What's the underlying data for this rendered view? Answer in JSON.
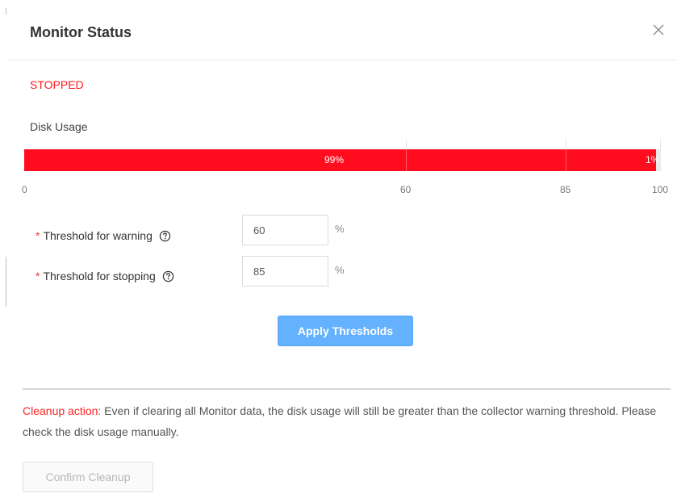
{
  "dialog": {
    "title": "Monitor Status"
  },
  "status": {
    "text": "STOPPED",
    "color": "#ff1a1a"
  },
  "disk_usage": {
    "label": "Disk Usage",
    "value_percent": 99.3,
    "value_label": "99%",
    "overflow_label": "1%",
    "bar_color": "#ff0c1e",
    "scale_max": 100,
    "ticks": [
      {
        "value": 0,
        "label": "0"
      },
      {
        "value": 60,
        "label": "60"
      },
      {
        "value": 85,
        "label": "85"
      },
      {
        "value": 100,
        "label": "100"
      }
    ]
  },
  "thresholds": {
    "warning": {
      "required_mark": "*",
      "label": "Threshold for warning",
      "value": "60",
      "unit": "%"
    },
    "stopping": {
      "required_mark": "*",
      "label": "Threshold for stopping",
      "value": "85",
      "unit": "%"
    },
    "apply_label": "Apply Thresholds",
    "apply_color": "#63b1ff"
  },
  "cleanup": {
    "heading": "Cleanup action:",
    "message": " Even if clearing all Monitor data, the disk usage will still be greater than the collector warning threshold. Please check the disk usage manually.",
    "confirm_label": "Confirm Cleanup"
  },
  "icons": {
    "close": "close-icon",
    "help": "question-circle-icon"
  }
}
